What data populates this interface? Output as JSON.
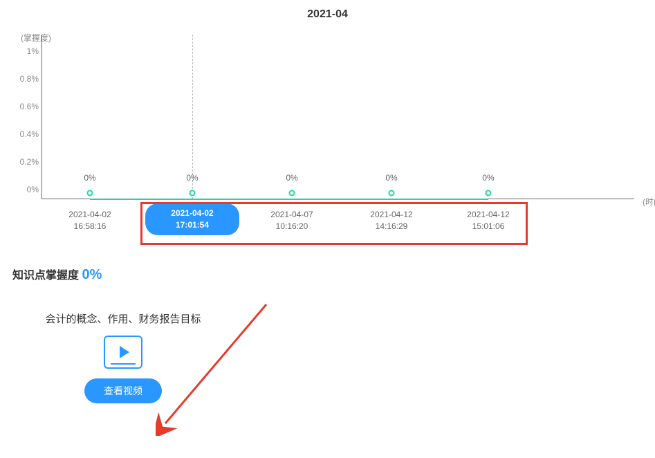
{
  "chart_data": {
    "type": "line",
    "title": "2021-04",
    "ylabel": "(掌握度)",
    "xlabel": "(时间)",
    "ylim": [
      0,
      1
    ],
    "y_ticks": [
      "0%",
      "0.2%",
      "0.4%",
      "0.6%",
      "0.8%",
      "1%"
    ],
    "categories": [
      "2021-04-02 16:58:16",
      "2021-04-02 17:01:54",
      "2021-04-07 10:16:20",
      "2021-04-12 14:16:29",
      "2021-04-12 15:01:06"
    ],
    "categories_lines": [
      [
        "2021-04-02",
        "16:58:16"
      ],
      [
        "2021-04-02",
        "17:01:54"
      ],
      [
        "2021-04-07",
        "10:16:20"
      ],
      [
        "2021-04-12",
        "14:16:29"
      ],
      [
        "2021-04-12",
        "15:01:06"
      ]
    ],
    "values": [
      0,
      0,
      0,
      0,
      0
    ],
    "value_labels": [
      "0%",
      "0%",
      "0%",
      "0%",
      "0%"
    ],
    "active_index": 1
  },
  "mastery": {
    "label": "知识点掌握度",
    "value": "0%"
  },
  "card": {
    "title": "会计的概念、作用、财务报告目标",
    "button": "查看视频"
  }
}
